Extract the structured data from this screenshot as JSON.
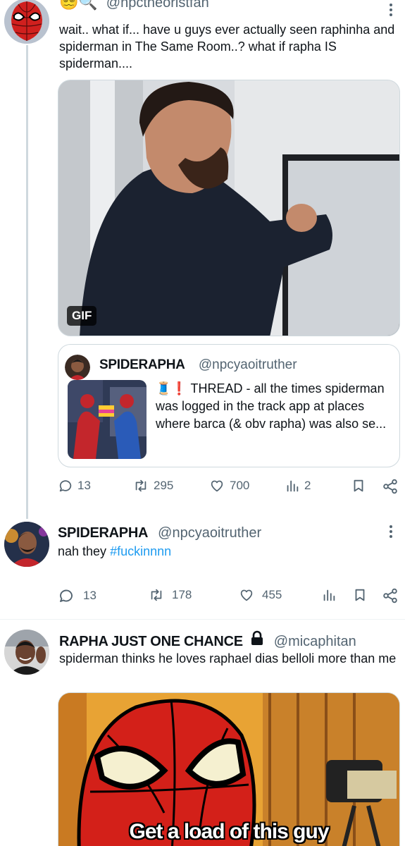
{
  "tweet1": {
    "handle": "@npctheoristfan",
    "emojis": "😵‍💫🔍",
    "text": "wait.. what if... have u guys ever actually seen raphinha and spiderman in The Same Room..? what if rapha IS spiderman....",
    "media_badge": "GIF",
    "quote": {
      "display_name": "SPIDERAPHA",
      "handle": "@npcyaoitruther",
      "text": "🧵❗ THREAD - all the times spiderman was logged in the track app at places where barca (& obv rapha) was also se..."
    },
    "actions": {
      "replies": "13",
      "retweets": "295",
      "likes": "700",
      "views": "2"
    }
  },
  "tweet2": {
    "display_name": "SPIDERAPHA",
    "handle": "@npcyaoitruther",
    "text_prefix": "nah they ",
    "hashtag": "#fuckinnnn",
    "actions": {
      "replies": "13",
      "retweets": "178",
      "likes": "455"
    }
  },
  "tweet3": {
    "display_name": "RAPHA JUST ONE CHANCE",
    "handle": "@micaphitan",
    "text": "spiderman thinks he loves raphael dias belloli more than me",
    "meme_caption": "Get a load of this guy"
  },
  "colors": {
    "accent": "#1d9bf0",
    "secondary_text": "#536471",
    "border": "#cfd9de"
  },
  "icons": [
    "reply-icon",
    "retweet-icon",
    "like-icon",
    "views-icon",
    "bookmark-icon",
    "share-icon",
    "more-icon",
    "lock-icon"
  ]
}
